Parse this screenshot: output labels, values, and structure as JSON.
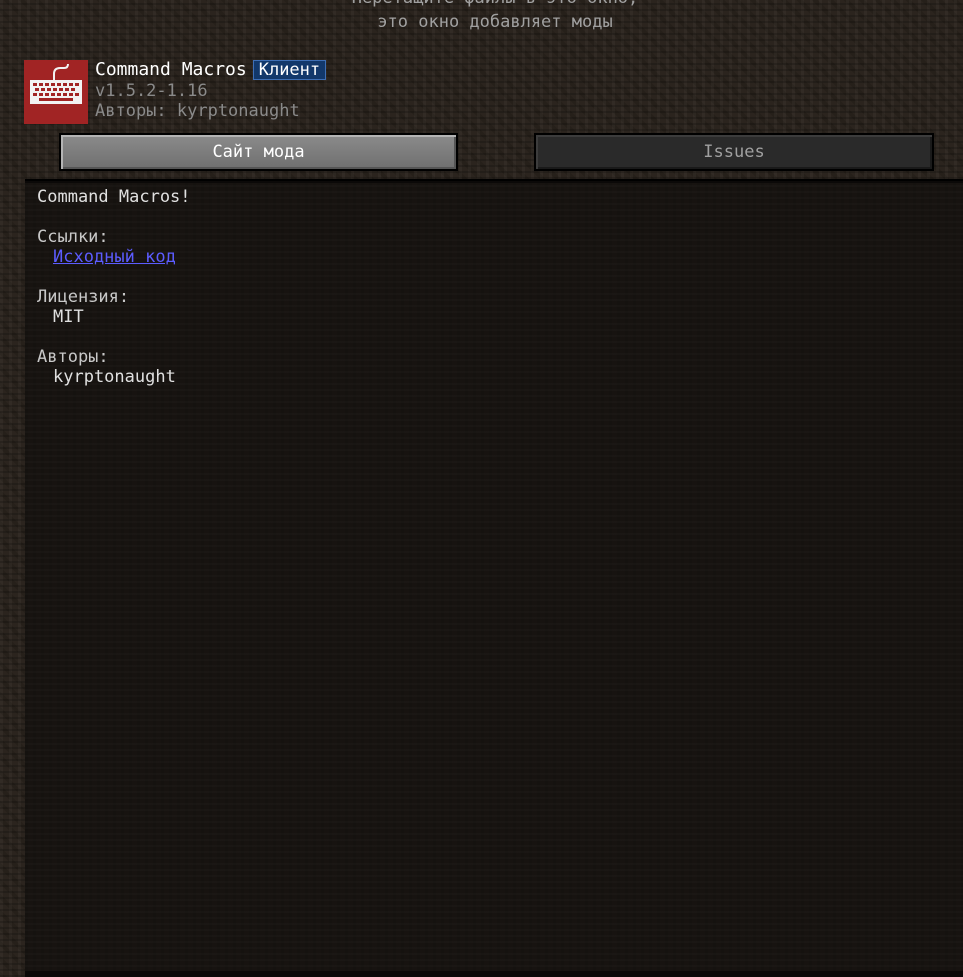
{
  "drop_hint": {
    "line1": "Перетащите файлы в это окно,",
    "line2": "это окно добавляет моды"
  },
  "mod": {
    "icon": "keyboard-icon",
    "name": "Command Macros",
    "environment_badge": "Клиент",
    "version": "v1.5.2-1.16",
    "authors_line": "Авторы: kyrptonaught"
  },
  "buttons": {
    "mod_site": "Сайт мода",
    "issues": "Issues"
  },
  "description": {
    "summary": "Command Macros!",
    "links_heading": "Ссылки:",
    "source_link": "Исходный код",
    "license_heading": "Лицензия:",
    "license_value": "MIT",
    "authors_heading": "Авторы:",
    "authors_value": "kyrptonaught"
  },
  "colors": {
    "badge_background": "#12386b",
    "link": "#5c5cff",
    "icon_background": "#a12424"
  }
}
